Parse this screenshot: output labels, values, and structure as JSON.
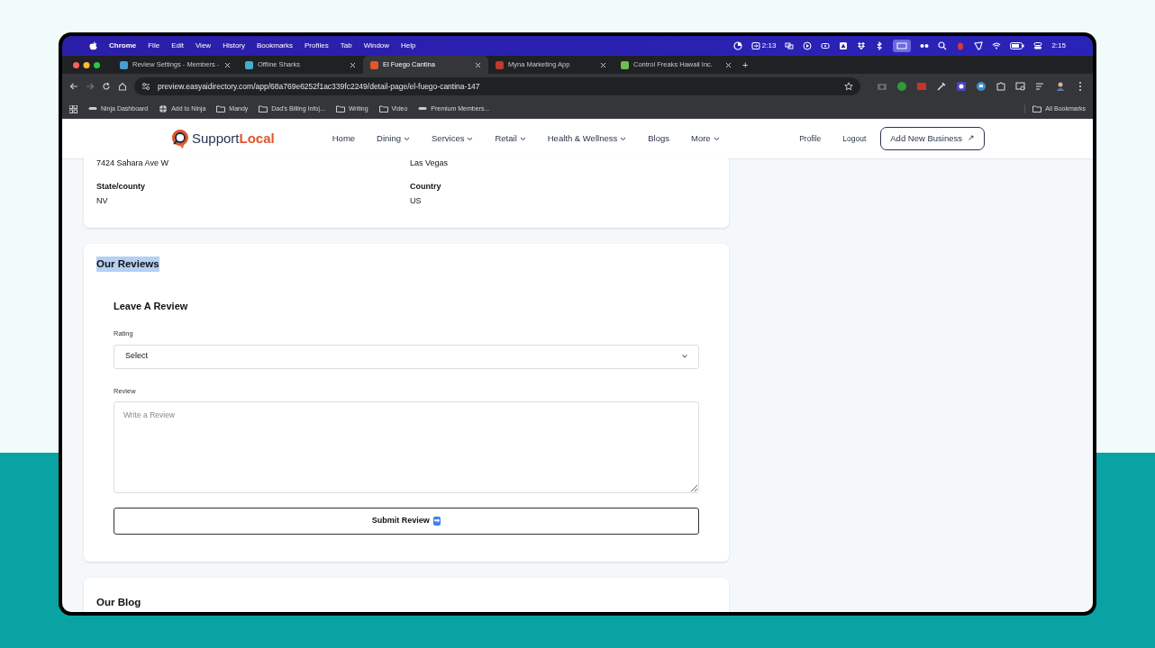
{
  "menu_bar": {
    "app": "Chrome",
    "items": [
      "File",
      "Edit",
      "View",
      "History",
      "Bookmarks",
      "Profiles",
      "Tab",
      "Window",
      "Help"
    ],
    "timer": "2:13",
    "clock": "2:15"
  },
  "tabs": [
    {
      "title": "Review Settings - Members -",
      "selected": false,
      "color": "#4a9bd6"
    },
    {
      "title": "Offline Sharks",
      "selected": false,
      "color": "#3fb0c9"
    },
    {
      "title": "El Fuego Cantina",
      "selected": true,
      "color": "#e0572a"
    },
    {
      "title": "Myna Marketing App",
      "selected": false,
      "color": "#c0392b"
    },
    {
      "title": "Control Freaks Hawaii Inc.",
      "selected": false,
      "color": "#6cbf4a"
    }
  ],
  "new_tab": "+",
  "address": "preview.easyaidirectory.com/app/68a769e6252f1ac339fc2249/detail-page/el-fuego-cantina-147",
  "bookmarks": [
    {
      "label": "Ninja Dashboard",
      "kind": "site"
    },
    {
      "label": "Add to Ninja",
      "kind": "globe"
    },
    {
      "label": "Mandy",
      "kind": "folder"
    },
    {
      "label": "Dad's Billing Info|...",
      "kind": "folder"
    },
    {
      "label": "Writing",
      "kind": "folder"
    },
    {
      "label": "Video",
      "kind": "folder"
    },
    {
      "label": "Premium Members...",
      "kind": "site"
    }
  ],
  "all_bookmarks": "All Bookmarks",
  "site_nav": {
    "logo_first": "Support",
    "logo_second": "Local",
    "links": [
      {
        "label": "Home",
        "dropdown": false
      },
      {
        "label": "Dining",
        "dropdown": true
      },
      {
        "label": "Services",
        "dropdown": true
      },
      {
        "label": "Retail",
        "dropdown": true
      },
      {
        "label": "Health & Wellness",
        "dropdown": true
      },
      {
        "label": "Blogs",
        "dropdown": false
      },
      {
        "label": "More",
        "dropdown": true
      }
    ],
    "profile": "Profile",
    "logout": "Logout",
    "cta": "Add New Business",
    "cta_icon": "↗"
  },
  "address_card": {
    "fields": [
      {
        "value": "7424 Sahara Ave W"
      },
      {
        "value": "Las Vegas"
      },
      {
        "label": "State/county",
        "value": "NV"
      },
      {
        "label": "Country",
        "value": "US"
      }
    ]
  },
  "reviews": {
    "title": "Our Reviews",
    "highlighted": true,
    "form_title": "Leave A Review",
    "rating_label": "Rating",
    "rating_value": "Select",
    "review_label": "Review",
    "review_placeholder": "Write a Review",
    "submit": "Submit Review",
    "submit_icon": "➡"
  },
  "blog": {
    "title": "Our Blog"
  }
}
